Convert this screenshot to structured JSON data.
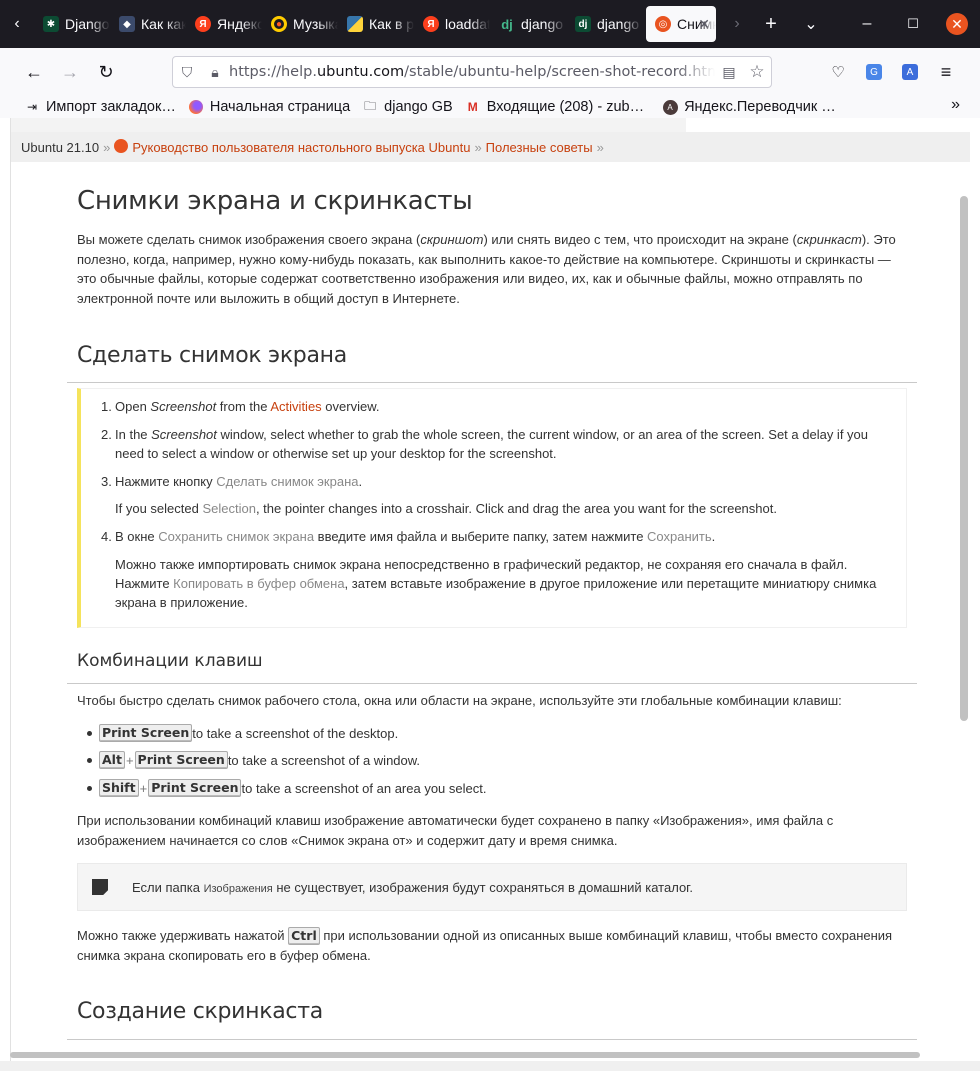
{
  "tabs": [
    {
      "label": "Django",
      "icon": "django-docs-icon",
      "color": "#0c4b33"
    },
    {
      "label": "Как как",
      "icon": "generic-site-icon",
      "color": "#3b4a6b"
    },
    {
      "label": "Яндекс",
      "icon": "yandex-icon",
      "color": "#fc3f1d"
    },
    {
      "label": "Музыка",
      "icon": "music-icon",
      "color": "#ffcc00"
    },
    {
      "label": "Как в python",
      "icon": "python-icon",
      "color": "#3776ab"
    },
    {
      "label": "loaddata",
      "icon": "yandex-icon",
      "color": "#fc3f1d"
    },
    {
      "label": "django",
      "icon": "django-dj-icon",
      "color": "#44b78b"
    },
    {
      "label": "django",
      "icon": "django-dj-icon",
      "color": "#0c4b33"
    },
    {
      "label": "Снимки",
      "icon": "ubuntu-icon",
      "color": "#e95420"
    }
  ],
  "url": {
    "prefix": "https://help.",
    "domain": "ubuntu.com",
    "path": "/stable/ubuntu-help/screen-shot-record.html"
  },
  "bookmarks": [
    {
      "label": "Импорт закладок…",
      "icon": "import-icon"
    },
    {
      "label": "Начальная страница",
      "icon": "firefox-icon"
    },
    {
      "label": "django GB",
      "icon": "folder-icon"
    },
    {
      "label": "Входящие (208) - zub…",
      "icon": "gmail-icon"
    },
    {
      "label": "Яндекс.Переводчик …",
      "icon": "translate-icon"
    }
  ],
  "breadcrumb": {
    "version": "Ubuntu 21.10",
    "guide": "Руководство пользователя настольного выпуска Ubuntu",
    "section": "Полезные советы"
  },
  "page": {
    "title": "Снимки экрана и скринкасты",
    "intro": [
      "Вы можете сделать снимок изображения своего экрана (",
      "скриншот",
      ") или снять видео с тем, что происходит на экране (",
      "скринкаст",
      "). Это полезно, когда, например, нужно кому-нибудь показать, как выполнить какое-то действие на компьютере. Скриншоты и скринкасты — это обычные файлы, которые содержат соответственно изображения или видео, их, как и обычные файлы, можно отправлять по электронной почте или выложить в общий доступ в Интернете."
    ],
    "section1_title": "Сделать снимок экрана",
    "steps": {
      "s1": {
        "num": "1.",
        "a": "Open ",
        "app": "Screenshot",
        "b": " from the ",
        "link": "Activities",
        "c": " overview."
      },
      "s2": {
        "num": "2.",
        "a": "In the ",
        "app": "Screenshot",
        "b": " window, select whether to grab the whole screen, the current window, or an area of the screen. Set a delay if you need to select a window or otherwise set up your desktop for the screenshot."
      },
      "s3": {
        "num": "3.",
        "a": "Нажмите кнопку ",
        "gui": "Сделать снимок экрана",
        "b": "."
      },
      "s3_note": {
        "a": "If you selected ",
        "gui": "Selection",
        "b": ", the pointer changes into a crosshair. Click and drag the area you want for the screenshot."
      },
      "s4": {
        "num": "4.",
        "a": "В окне ",
        "gui1": "Сохранить снимок экрана",
        "b": " введите имя файла и выберите папку, затем нажмите ",
        "gui2": "Сохранить",
        "c": "."
      },
      "s4_note": {
        "a": "Можно также импортировать снимок экрана непосредственно в графический редактор, не сохраняя его сначала в файл. Нажмите ",
        "gui": "Копировать в буфер обмена",
        "b": ", затем вставьте изображение в другое приложение или перетащите миниатюру снимка экрана в приложение."
      }
    },
    "shortcuts_title": "Комбинации клавиш",
    "shortcuts_intro": "Чтобы быстро сделать снимок рабочего стола, окна или области на экране, используйте эти глобальные комбинации клавиш:",
    "shortcuts": {
      "k1": {
        "key": "Print Screen",
        "text": " to take a screenshot of the desktop."
      },
      "k2": {
        "mod": "Alt",
        "key": "Print Screen",
        "text": " to take a screenshot of a window."
      },
      "k3": {
        "mod": "Shift",
        "key": "Print Screen",
        "text": " to take a screenshot of an area you select."
      },
      "plus": "+"
    },
    "autosave": "При использовании комбинаций клавиш изображение автоматически будет сохранено в папку «Изображения», имя файла с изображением начинается со слов «Снимок экрана от» и содержит дату и время снимка.",
    "note": {
      "a": "Если папка ",
      "file": "Изображения",
      "b": " не существует, изображения будут сохраняться в домашний каталог."
    },
    "ctrl": {
      "a": "Можно также удерживать нажатой ",
      "key": "Ctrl",
      "b": " при использовании одной из описанных выше комбинаций клавиш, чтобы вместо сохранения снимка экрана скопировать его в буфер обмена."
    },
    "section2_title": "Создание скринкаста"
  }
}
